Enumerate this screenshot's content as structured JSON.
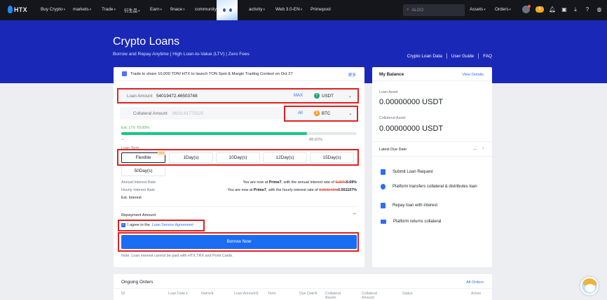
{
  "nav": {
    "logo": "HTX",
    "items": [
      {
        "label": "Buy Crypto",
        "caret": true
      },
      {
        "label": "markets",
        "caret": true
      },
      {
        "label": "Trade",
        "caret": true
      },
      {
        "label": "衍生品",
        "caret": true
      },
      {
        "label": "Earn",
        "caret": true
      },
      {
        "label": "finace",
        "caret": true
      },
      {
        "label": "community",
        "caret": false
      },
      {
        "label": "activity",
        "caret": true
      },
      {
        "label": "Web 3.0-EN",
        "caret": true
      },
      {
        "label": "Primepool",
        "caret": false
      }
    ],
    "search_placeholder": "ALGO",
    "assets": "Assets",
    "orders": "Orders",
    "badge": "5"
  },
  "hero": {
    "title": "Crypto Loans",
    "subtitle": "Borrow and Repay Anytime | High Loan-to-Value (LTV) | Zero Fees",
    "links": [
      "Crypto Loan Data",
      "User Guide",
      "FAQ"
    ]
  },
  "loan": {
    "promo": "Trade to share 10,000 TON! HTX to launch TON Spot & Margin Trading Contest on Oct 27",
    "promo_more": "更多",
    "loan_label": "Loan Amount",
    "loan_value": "54019472.46503748",
    "max_label": "MAX",
    "loan_coin": "USDT",
    "collateral_label": "Collateral Amount",
    "collateral_value": "8633.81775525",
    "all_label": "All",
    "collateral_coin": "BTC",
    "ltv_label": "Est. LTV 79.00%",
    "ltv_fraction": 0.79,
    "ltv_dash": "--",
    "ltv_max": "88.82%",
    "term_label": "Loan Term",
    "terms": [
      "Flexible",
      "1Day(s)",
      "10Day(s)",
      "12Day(s)",
      "15Day(s)",
      "50Day(s)"
    ],
    "hot": "Hot",
    "annual_label": "Annual Interest Rate",
    "annual_prefix": "You are now at ",
    "annual_tier": "Prime7",
    "annual_mid": ", with the annual interest rate of ",
    "annual_old": "9.99%",
    "annual_new": "9.69%",
    "hourly_label": "Hourly Interest Rate",
    "hourly_prefix": "You are now at ",
    "hourly_tier": "Prime7",
    "hourly_mid": ", with the hourly interest rate of ",
    "hourly_old": "0.001141%",
    "hourly_new": "0.001107%",
    "interest_label": "Est. Interest",
    "repay_label": "Repayment Amount",
    "repay_value": "--",
    "agree_prefix": "I agree to the ",
    "agree_link": "Loan Service Agreement",
    "borrow_label": "Borrow Now",
    "note": "Note: Loan interest cannot be paid with HTX,TRX and Point Cards."
  },
  "balance": {
    "title": "My Balance",
    "view": "View Details",
    "loan_asset_label": "Loan Asset",
    "loan_asset_value": "0.00000000 USDT",
    "collateral_asset_label": "Collateral Asset",
    "collateral_asset_value": "0.00000000 USDT",
    "due_label": "Latest Due Date",
    "due_value": "--",
    "steps": [
      "Submit Loan Request",
      "Platform transfers collateral & distributes loan",
      "Repay loan with interest",
      "Platform returns collateral"
    ]
  },
  "orders": {
    "title": "Ongoing Orders",
    "all": "All Orders",
    "columns": [
      "ID",
      "Loan Date",
      "Name",
      "Loan Amount",
      "Term",
      "Due Date",
      "Collateral Assets",
      "Collateral Amount",
      "Status",
      "Action"
    ]
  },
  "colors": {
    "hero_bg": "#1a28b8",
    "accent": "#1a6cf2",
    "ltv_green": "#16c784",
    "highlight": "#e02020"
  }
}
